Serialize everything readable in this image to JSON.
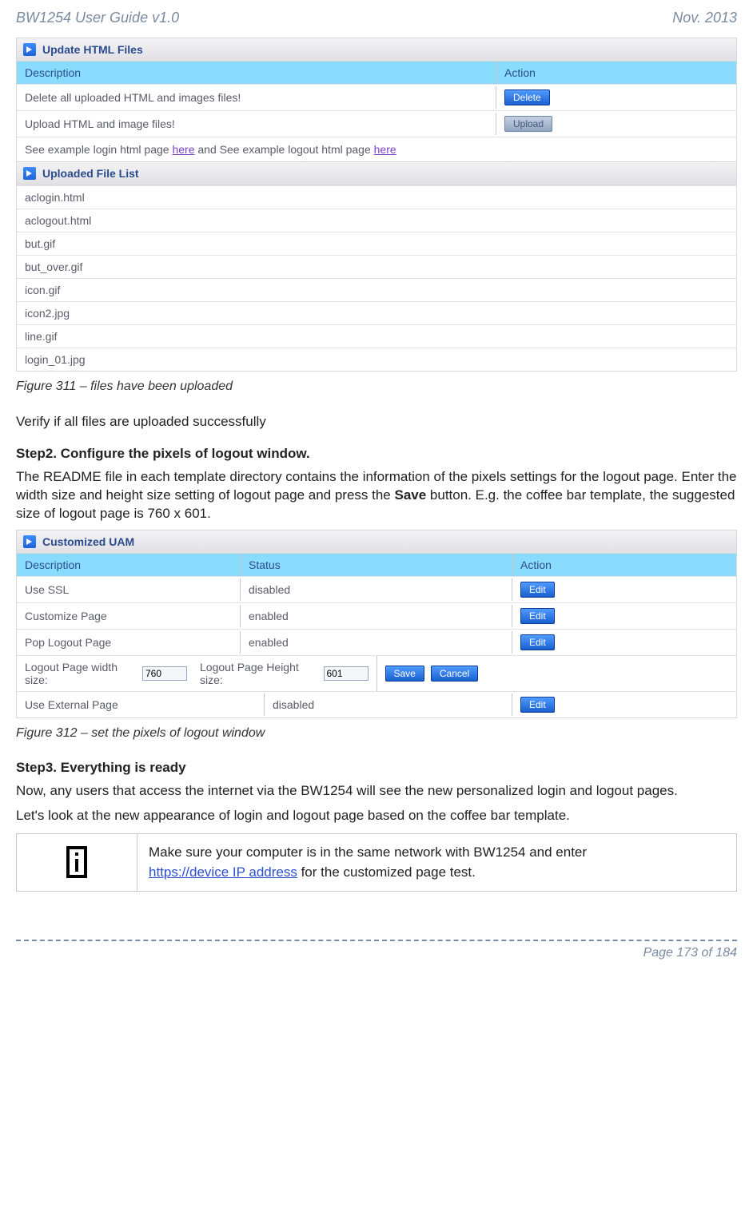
{
  "header": {
    "left": "BW1254 User Guide v1.0",
    "right": "Nov.  2013"
  },
  "panel1": {
    "title": "Update HTML Files",
    "head_desc": "Description",
    "head_action": "Action",
    "rows": [
      {
        "desc": "Delete all uploaded HTML and images files!",
        "btn": "Delete",
        "btn_active": true
      },
      {
        "desc": "Upload HTML and image files!",
        "btn": "Upload",
        "btn_active": false
      }
    ],
    "example_prefix": "See example login html page ",
    "example_here1": "here",
    "example_mid": " and See example logout html page ",
    "example_here2": "here"
  },
  "panel2": {
    "title": "Uploaded File List",
    "files": [
      "aclogin.html",
      "aclogout.html",
      "but.gif",
      "but_over.gif",
      "icon.gif",
      "icon2.jpg",
      "line.gif",
      "login_01.jpg"
    ]
  },
  "fig1_caption": "Figure 311  – files have been uploaded",
  "verify_text": "Verify if all files are uploaded successfully",
  "step2_heading": "Step2. Configure the pixels of logout window.",
  "step2_text_prefix": "The README file in each template directory contains the information of the pixels settings for the logout page. Enter the width size and height size setting of logout page and press the ",
  "step2_save_word": "Save",
  "step2_text_suffix": " button. E.g. the coffee bar template, the suggested size of logout page is 760 x 601.",
  "panel3": {
    "title": "Customized UAM",
    "head_desc": "Description",
    "head_status": "Status",
    "head_action": "Action",
    "rows": [
      {
        "desc": "Use SSL",
        "status": "disabled",
        "btn": "Edit"
      },
      {
        "desc": "Customize Page",
        "status": "enabled",
        "btn": "Edit"
      },
      {
        "desc": "Pop Logout Page",
        "status": "enabled",
        "btn": "Edit"
      }
    ],
    "logout_row": {
      "width_label": "Logout Page width size:",
      "width_val": "760",
      "height_label": "Logout Page Height size:",
      "height_val": "601",
      "save_btn": "Save",
      "cancel_btn": "Cancel"
    },
    "ext_row": {
      "desc": "Use External Page",
      "status": "disabled",
      "btn": "Edit"
    }
  },
  "fig2_caption": "Figure 312  – set the pixels of logout window",
  "step3_heading": "Step3. Everything is ready",
  "step3_p1": "Now, any users that access the internet via the BW1254 will see the new personalized login and logout pages.",
  "step3_p2": "Let's look at the new appearance of login and logout page based on the coffee bar template.",
  "note": {
    "line1": "Make sure your computer is in the same network with BW1254 and enter",
    "link": " https://device IP address",
    "after": " for the customized page test."
  },
  "footer": "Page 173 of 184"
}
